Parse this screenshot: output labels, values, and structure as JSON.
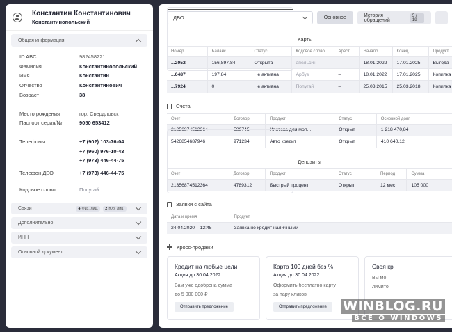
{
  "client": {
    "name": "Константин Константинович",
    "surname": "Константинопольский"
  },
  "sections": {
    "general": "Общая информация",
    "links": "Связи",
    "extra": "Дополнительно",
    "inn": "ИНН",
    "main_doc": "Основной документ"
  },
  "links_tags": [
    {
      "count": "4",
      "label": "Физ. лиц."
    },
    {
      "count": "2",
      "label": "Юр. лиц."
    }
  ],
  "fields": [
    {
      "k": "ID ABC",
      "v": "982458221",
      "style": "light"
    },
    {
      "k": "Фамилия",
      "v": "Константинопольский",
      "style": "bold"
    },
    {
      "k": "Имя",
      "v": "Константин",
      "style": "bold"
    },
    {
      "k": "Отчество",
      "v": "Константинович",
      "style": "bold"
    },
    {
      "k": "Возраст",
      "v": "38",
      "style": "bold"
    }
  ],
  "fields2": [
    {
      "k": "Место рождения",
      "v": "гор. Свердловск"
    },
    {
      "k": "Паспорт серия/№",
      "v": "9050 653412"
    }
  ],
  "phones": {
    "label": "Телефоны",
    "values": [
      "+7 (902) 103-76-04",
      "+7 (960) 976-10-43",
      "+7 (973) 446-44-75"
    ]
  },
  "phone_dbo": {
    "label": "Телефон ДБО",
    "value": "+7 (973) 446-44-75"
  },
  "code_word": {
    "label": "Кодовое слово",
    "value": "Попугай"
  },
  "topbar": {
    "select": "ДБО",
    "btn_main": "Основное",
    "btn_history": "История обращений",
    "history_badge": "5 / 18"
  },
  "cards_block": {
    "title": "Карты",
    "headers": [
      "Номер",
      "Баланс",
      "Статус",
      "Кодовое слово",
      "Арест",
      "Начало",
      "Конец",
      "Продукт"
    ],
    "rows": [
      [
        "...2052",
        "156,897.84",
        "Открыта",
        "апельсин",
        "–",
        "18.01.2022",
        "17.01.2025",
        "Выгода"
      ],
      [
        "...6487",
        "197.84",
        "Не активна",
        "Арбуз",
        "–",
        "18.01.2022",
        "17.01.2025",
        "Копилка"
      ],
      [
        "...7924",
        "0",
        "Не активна",
        "Попугай",
        "–",
        "25.03.2015",
        "25.03.2018",
        "Копилка"
      ]
    ]
  },
  "accounts_block": {
    "title": "Счета",
    "headers": [
      "Счет",
      "Договор",
      "Продукт",
      "Статус",
      "Основной долг"
    ],
    "rows": [
      [
        "21356874512364",
        "589745",
        "Ипотека для мол...",
        "Открыт",
        "1 218 470,84"
      ],
      [
        "5426854687946",
        "971234",
        "Авто кредит",
        "Открыт",
        "410 640,12"
      ]
    ]
  },
  "deposits_block": {
    "title": "Депозиты",
    "headers": [
      "Счет",
      "Договор",
      "Продукт",
      "Статус",
      "Период",
      "Сумма"
    ],
    "rows": [
      [
        "21356874512364",
        "4789312",
        "Быстрый процент",
        "Открыт",
        "12 мес.",
        "105 000"
      ]
    ]
  },
  "requests_block": {
    "title": "Заявки с сайта",
    "headers": [
      "Дата и время",
      "Продукт"
    ],
    "rows": [
      [
        "24.04.2020    12:45",
        "Заявка не кредит наличными"
      ]
    ]
  },
  "cross": {
    "title": "Кросс-продажи",
    "cards": [
      {
        "title": "Кредит на любые цели",
        "sub": "Акция до 30.04.2022",
        "d1": "Вам уже одобрена сумма",
        "d2": "до 5 000 000 ₽",
        "btn": "Отправить предложение"
      },
      {
        "title": "Карта 100 дней без %",
        "sub": "Акция до 30.04.2022",
        "d1": "Оформить бесплатно карту",
        "d2": "за пару кликов",
        "btn": "Отправить предложение"
      },
      {
        "title": "Своя кр",
        "sub": "",
        "d1": "Вы мо",
        "d2": "лимито",
        "btn": ""
      }
    ]
  },
  "watermark": {
    "line1": "WINBLOG.RU",
    "line2": "ВСЁ О WINDOWS"
  }
}
